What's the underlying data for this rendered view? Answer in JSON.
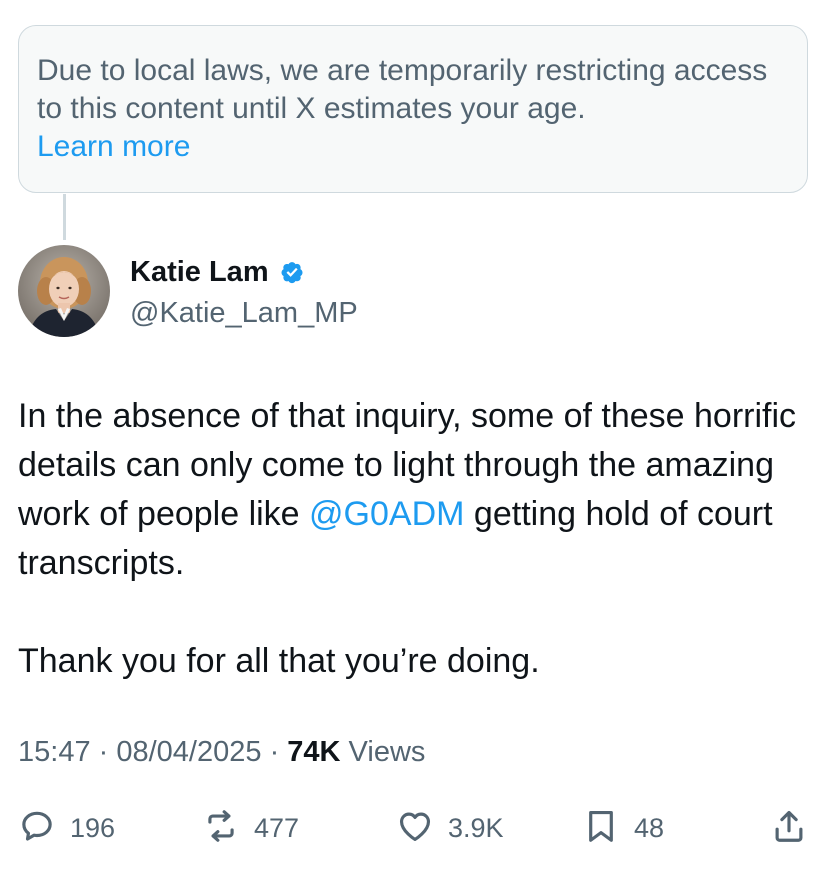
{
  "notice": {
    "text": "Due to local laws, we are temporarily restricting access to this content until X estimates your age.",
    "link": "Learn more"
  },
  "author": {
    "name": "Katie Lam",
    "handle": "@Katie_Lam_MP"
  },
  "tweet": {
    "line1_before": "In the absence of that inquiry, some of these horrific details can only come to light through the amazing work of people like ",
    "mention": "@G0ADM",
    "line1_after": " getting hold of court transcripts.",
    "paragraph2": "Thank you for all that you’re doing."
  },
  "meta": {
    "time": "15:47",
    "sep1": " · ",
    "date": "08/04/2025",
    "sep2": " · ",
    "views_count": "74K",
    "views_label": " Views"
  },
  "actions": {
    "replies": "196",
    "reposts": "477",
    "likes": "3.9K",
    "bookmarks": "48"
  },
  "icons": {
    "reply": "reply-icon",
    "repost": "repost-icon",
    "like": "like-icon",
    "bookmark": "bookmark-icon",
    "share": "share-icon",
    "verified": "verified-badge-icon"
  },
  "colors": {
    "accent": "#1d9bf0",
    "text": "#0f1419",
    "secondary": "#536471",
    "notice_bg": "#f7f9f9",
    "border": "#cfd9de"
  }
}
